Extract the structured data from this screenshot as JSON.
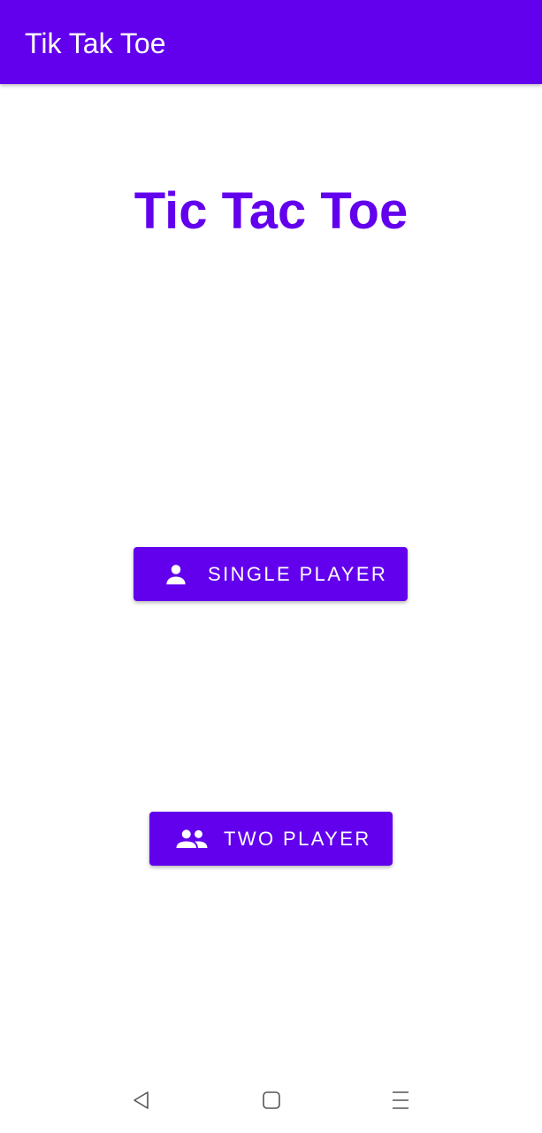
{
  "app_bar": {
    "title": "Tik Tak Toe",
    "color": "#6200EE"
  },
  "main": {
    "game_title": "Tic Tac Toe",
    "buttons": [
      {
        "label": "SINGLE PLAYER",
        "icon": "person-icon"
      },
      {
        "label": "TWO PLAYER",
        "icon": "people-icon"
      }
    ]
  },
  "nav_bar": {
    "icons": [
      "back-triangle-icon",
      "home-square-icon",
      "menu-lines-icon"
    ],
    "icon_color": "#555555"
  },
  "colors": {
    "primary": "#6200EE",
    "on_primary": "#FFFFFF",
    "background": "#FFFFFF"
  }
}
